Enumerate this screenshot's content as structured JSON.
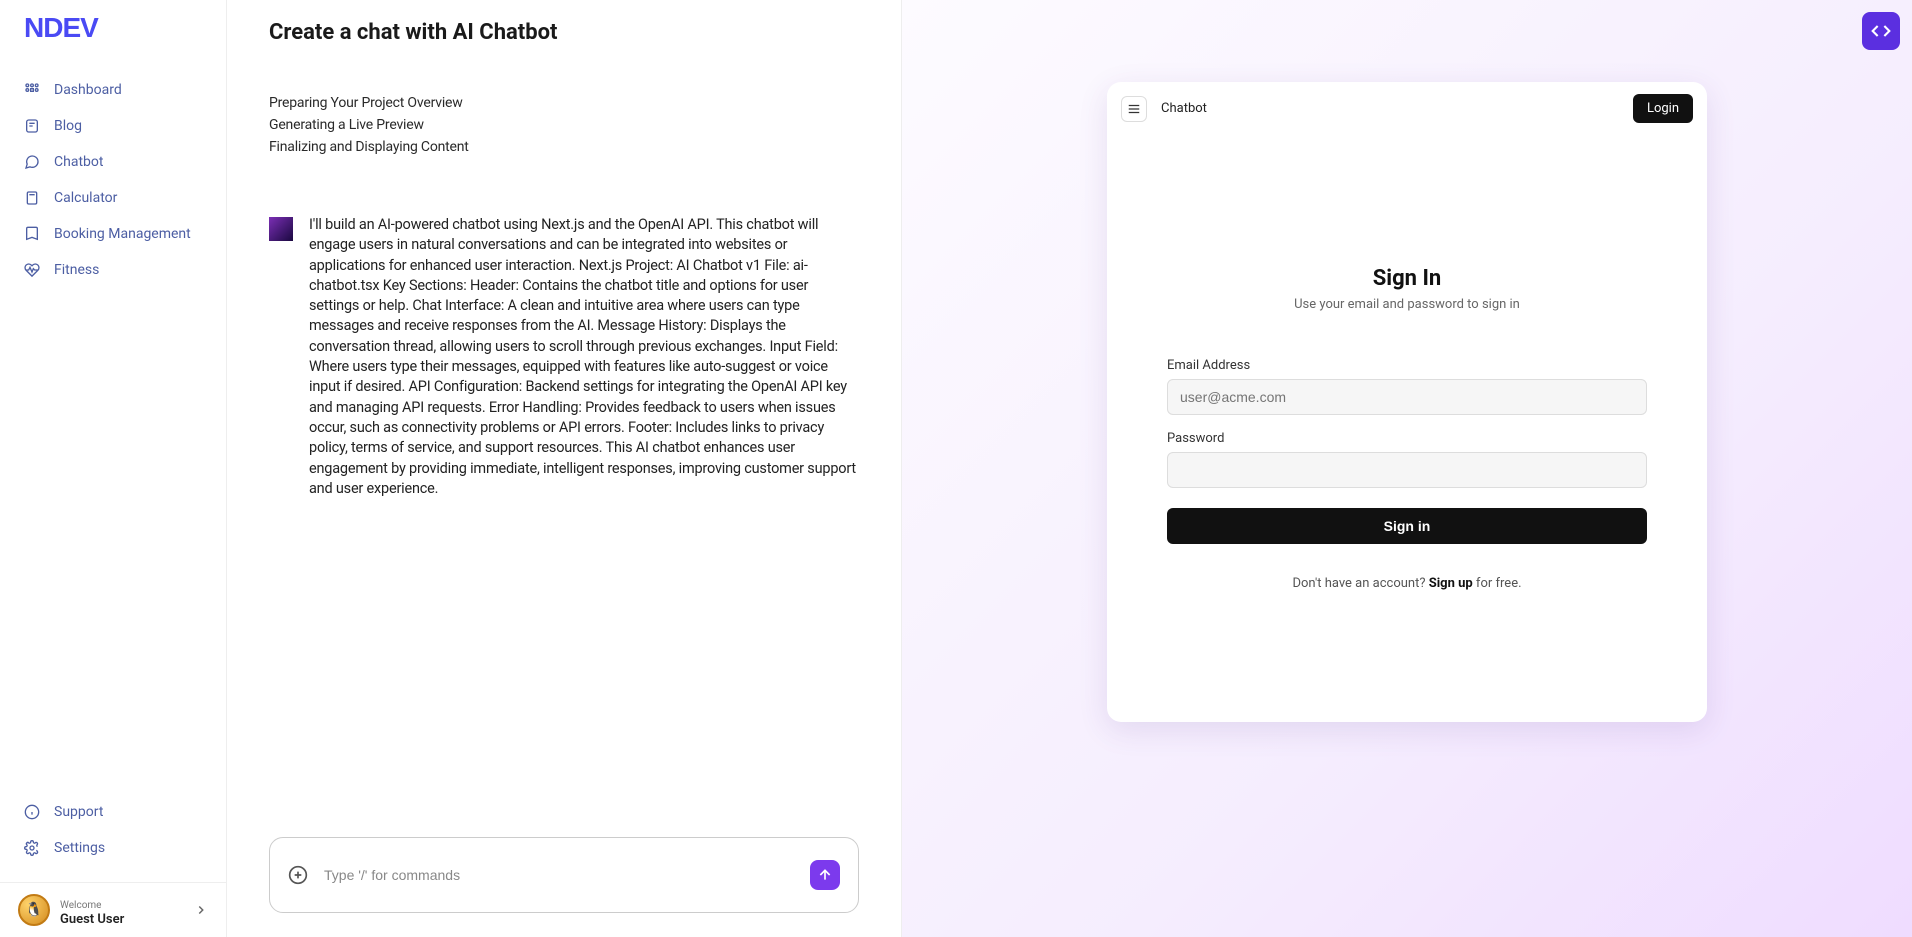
{
  "brand": "NDEV",
  "sidebar": {
    "items": [
      {
        "icon": "grid",
        "label": "Dashboard"
      },
      {
        "icon": "blog",
        "label": "Blog"
      },
      {
        "icon": "chat",
        "label": "Chatbot"
      },
      {
        "icon": "calc",
        "label": "Calculator"
      },
      {
        "icon": "book",
        "label": "Booking Management"
      },
      {
        "icon": "heart",
        "label": "Fitness"
      }
    ],
    "footer": [
      {
        "icon": "info",
        "label": "Support"
      },
      {
        "icon": "gear",
        "label": "Settings"
      }
    ],
    "user": {
      "welcome": "Welcome",
      "name": "Guest User"
    }
  },
  "center": {
    "title": "Create a chat with AI Chatbot",
    "status": [
      "Preparing Your Project Overview",
      "Generating a Live Preview",
      "Finalizing and Displaying Content"
    ],
    "message": "I'll build an AI-powered chatbot using Next.js and the OpenAI API. This chatbot will engage users in natural conversations and can be integrated into websites or applications for enhanced user interaction. Next.js Project: AI Chatbot v1 File: ai-chatbot.tsx Key Sections: Header: Contains the chatbot title and options for user settings or help. Chat Interface: A clean and intuitive area where users can type messages and receive responses from the AI. Message History: Displays the conversation thread, allowing users to scroll through previous exchanges. Input Field: Where users type their messages, equipped with features like auto-suggest or voice input if desired. API Configuration: Backend settings for integrating the OpenAI API key and managing API requests. Error Handling: Provides feedback to users when issues occur, such as connectivity problems or API errors. Footer: Includes links to privacy policy, terms of service, and support resources. This AI chatbot enhances user engagement by providing immediate, intelligent responses, improving customer support and user experience.",
    "prompt_placeholder": "Type '/' for commands"
  },
  "preview": {
    "header_title": "Chatbot",
    "login_btn": "Login",
    "signin_title": "Sign In",
    "signin_sub": "Use your email and password to sign in",
    "email_label": "Email Address",
    "email_placeholder": "user@acme.com",
    "password_label": "Password",
    "signin_btn": "Sign in",
    "signup_prompt": "Don't have an account? ",
    "signup_link": "Sign up",
    "signup_tail": " for free."
  }
}
